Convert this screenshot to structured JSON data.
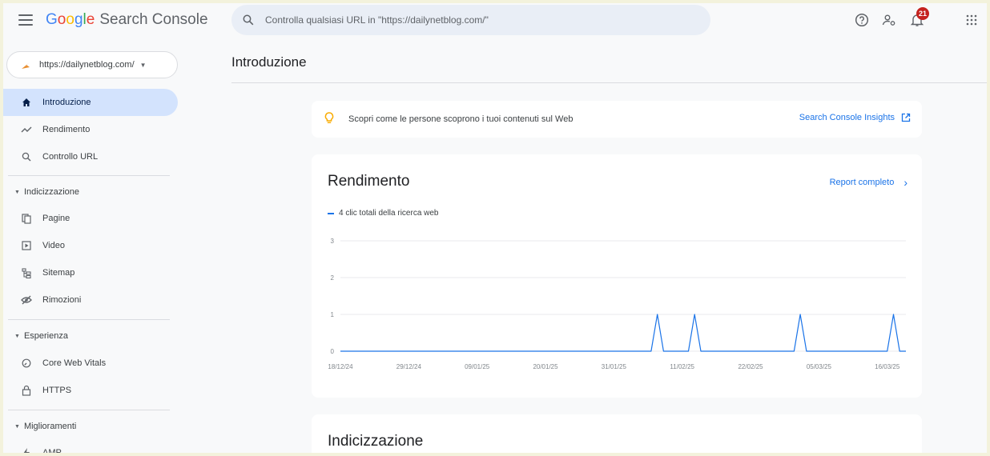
{
  "app": {
    "brand_letters": [
      "G",
      "o",
      "o",
      "g",
      "l",
      "e"
    ],
    "product": "Search Console",
    "search_placeholder": "Controlla qualsiasi URL in \"https://dailynetblog.com/\"",
    "notifications_count": "21"
  },
  "sidebar": {
    "property": "https://dailynetblog.com/",
    "items": [
      {
        "label": "Introduzione",
        "icon": "home-icon",
        "active": true
      },
      {
        "label": "Rendimento",
        "icon": "trending-icon"
      },
      {
        "label": "Controllo URL",
        "icon": "search-icon"
      }
    ],
    "sections": [
      {
        "label": "Indicizzazione",
        "items": [
          {
            "label": "Pagine",
            "icon": "pages-icon"
          },
          {
            "label": "Video",
            "icon": "video-icon"
          },
          {
            "label": "Sitemap",
            "icon": "sitemap-icon"
          },
          {
            "label": "Rimozioni",
            "icon": "removals-icon"
          }
        ]
      },
      {
        "label": "Esperienza",
        "items": [
          {
            "label": "Core Web Vitals",
            "icon": "gauge-icon"
          },
          {
            "label": "HTTPS",
            "icon": "lock-icon"
          }
        ]
      },
      {
        "label": "Miglioramenti",
        "items": [
          {
            "label": "AMP",
            "icon": "bolt-icon"
          }
        ]
      }
    ]
  },
  "main": {
    "page_title": "Introduzione",
    "insights": {
      "text": "Scopri come le persone scoprono i tuoi contenuti sul Web",
      "link": "Search Console Insights"
    },
    "performance": {
      "title": "Rendimento",
      "report_link": "Report completo",
      "legend": "4 clic totali della ricerca web"
    },
    "indexing": {
      "title": "Indicizzazione"
    }
  },
  "colors": {
    "accent": "#1a73e8",
    "active_nav": "#d3e3fd"
  },
  "chart_data": {
    "type": "line",
    "ylim": [
      0,
      3
    ],
    "y_ticks": [
      "0",
      "1",
      "2",
      "3"
    ],
    "x_tick_labels": [
      "18/12/24",
      "29/12/24",
      "09/01/25",
      "20/01/25",
      "31/01/25",
      "11/02/25",
      "22/02/25",
      "05/03/25",
      "16/03/25"
    ],
    "x_start": "18/12/24",
    "x_end": "19/03/25",
    "grid": true,
    "series": [
      {
        "name": "4 clic totali della ricerca web",
        "color": "#1a73e8",
        "points": [
          [
            "18/12/24",
            0
          ],
          [
            "06/02/25",
            0
          ],
          [
            "07/02/25",
            1
          ],
          [
            "08/02/25",
            0
          ],
          [
            "12/02/25",
            0
          ],
          [
            "13/02/25",
            1
          ],
          [
            "14/02/25",
            0
          ],
          [
            "01/03/25",
            0
          ],
          [
            "02/03/25",
            1
          ],
          [
            "03/03/25",
            0
          ],
          [
            "16/03/25",
            0
          ],
          [
            "17/03/25",
            1
          ],
          [
            "18/03/25",
            0
          ],
          [
            "19/03/25",
            0
          ]
        ]
      }
    ]
  }
}
